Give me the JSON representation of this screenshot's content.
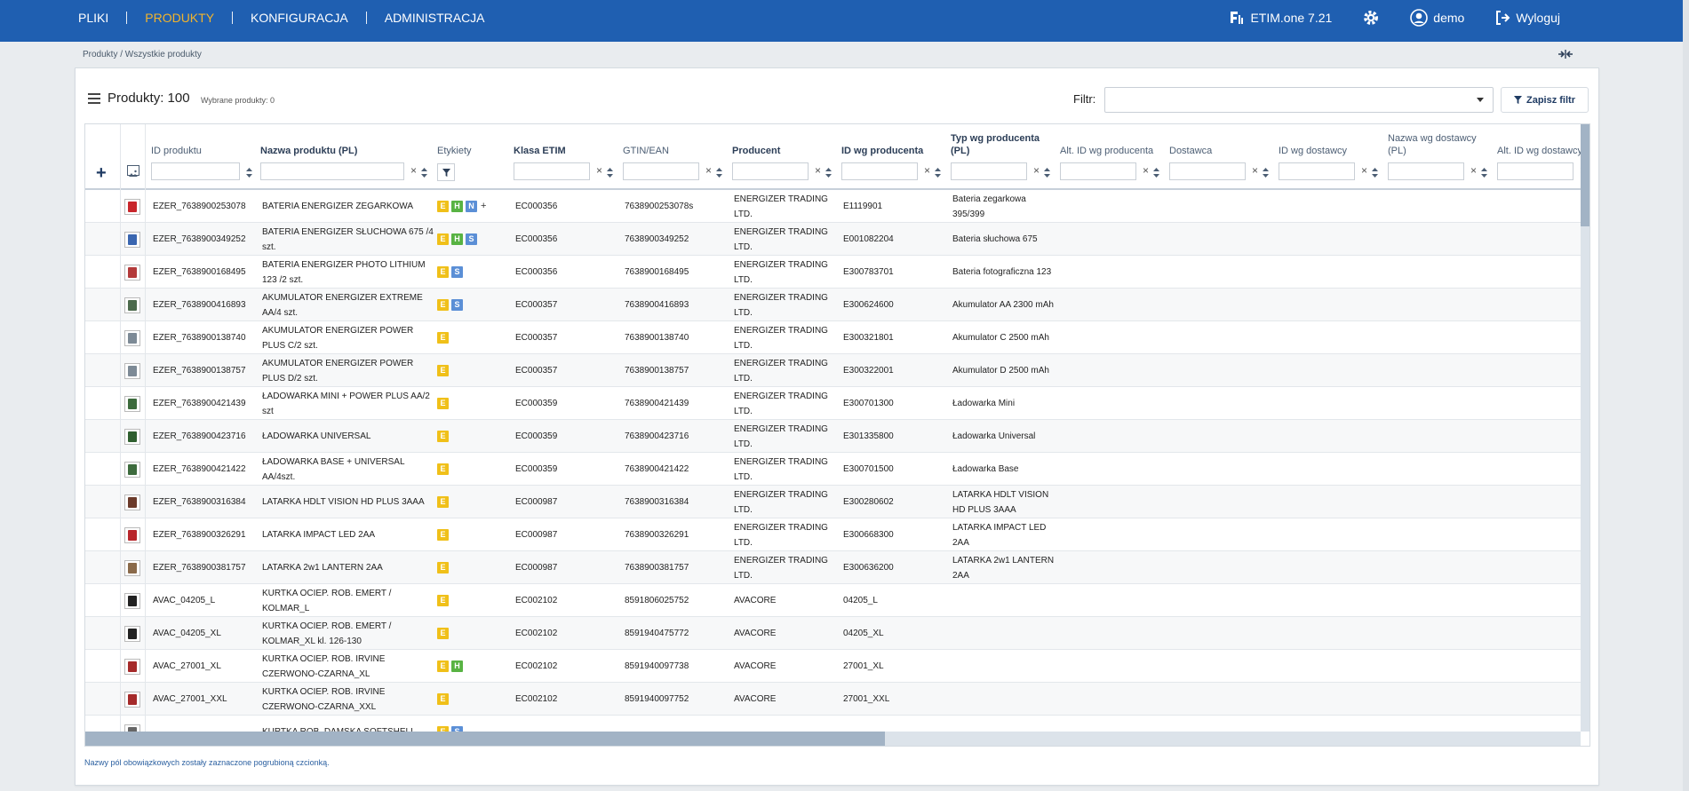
{
  "nav": {
    "items": [
      {
        "label": "PLIKI",
        "active": false
      },
      {
        "label": "PRODUKTY",
        "active": true
      },
      {
        "label": "KONFIGURACJA",
        "active": false
      },
      {
        "label": "ADMINISTRACJA",
        "active": false
      }
    ],
    "version": "ETIM.one 7.21",
    "user": "demo",
    "logout": "Wyloguj"
  },
  "breadcrumb": "Produkty / Wszystkie produkty",
  "panel": {
    "title": "Produkty: 100",
    "selected": "Wybrane produkty: 0",
    "filter_label": "Filtr:",
    "filter_value": "",
    "save_filter": "Zapisz filtr"
  },
  "columns": [
    {
      "label": "ID produktu",
      "required": false
    },
    {
      "label": "Nazwa produktu (PL)",
      "required": true
    },
    {
      "label": "Etykiety",
      "required": false
    },
    {
      "label": "Klasa ETIM",
      "required": true
    },
    {
      "label": "GTIN/EAN",
      "required": false
    },
    {
      "label": "Producent",
      "required": true
    },
    {
      "label": "ID wg producenta",
      "required": true
    },
    {
      "label": "Typ wg producenta (PL)",
      "required": true
    },
    {
      "label": "Alt. ID wg producenta",
      "required": false
    },
    {
      "label": "Dostawca",
      "required": false
    },
    {
      "label": "ID wg dostawcy",
      "required": false
    },
    {
      "label": "Nazwa wg dostawcy (PL)",
      "required": false
    },
    {
      "label": "Alt. ID wg dostawcy",
      "required": false
    }
  ],
  "rows": [
    {
      "thumb": "#c8262b",
      "id": "EZER_7638900253078",
      "name": "BATERIA ENERGIZER ZEGARKOWA",
      "tags": [
        "E",
        "H",
        "N"
      ],
      "more": "+",
      "cls": "EC000356",
      "gtin": "7638900253078s",
      "prod": "ENERGIZER TRADING LTD.",
      "pid": "E1119901",
      "ptype": "Bateria zegarkowa 395/399"
    },
    {
      "thumb": "#3a66b0",
      "id": "EZER_7638900349252",
      "name": "BATERIA ENERGIZER SŁUCHOWA 675 /4 szt.",
      "tags": [
        "E",
        "H",
        "S"
      ],
      "more": "",
      "cls": "EC000356",
      "gtin": "7638900349252",
      "prod": "ENERGIZER TRADING LTD.",
      "pid": "E001082204",
      "ptype": "Bateria słuchowa 675"
    },
    {
      "thumb": "#b33a3a",
      "id": "EZER_7638900168495",
      "name": "BATERIA ENERGIZER PHOTO LITHIUM 123 /2 szt.",
      "tags": [
        "E",
        "S"
      ],
      "more": "",
      "cls": "EC000356",
      "gtin": "7638900168495",
      "prod": "ENERGIZER TRADING LTD.",
      "pid": "E300783701",
      "ptype": "Bateria fotograficzna 123"
    },
    {
      "thumb": "#4c6a4c",
      "id": "EZER_7638900416893",
      "name": "AKUMULATOR ENERGIZER EXTREME AA/4 szt.",
      "tags": [
        "E",
        "S"
      ],
      "more": "",
      "cls": "EC000357",
      "gtin": "7638900416893",
      "prod": "ENERGIZER TRADING LTD.",
      "pid": "E300624600",
      "ptype": "Akumulator AA 2300 mAh"
    },
    {
      "thumb": "#7d8a96",
      "id": "EZER_7638900138740",
      "name": "AKUMULATOR ENERGIZER POWER PLUS C/2 szt.",
      "tags": [
        "E"
      ],
      "more": "",
      "cls": "EC000357",
      "gtin": "7638900138740",
      "prod": "ENERGIZER TRADING LTD.",
      "pid": "E300321801",
      "ptype": "Akumulator C 2500 mAh"
    },
    {
      "thumb": "#7d8a96",
      "id": "EZER_7638900138757",
      "name": "AKUMULATOR ENERGIZER POWER PLUS D/2 szt.",
      "tags": [
        "E"
      ],
      "more": "",
      "cls": "EC000357",
      "gtin": "7638900138757",
      "prod": "ENERGIZER TRADING LTD.",
      "pid": "E300322001",
      "ptype": "Akumulator D 2500 mAh"
    },
    {
      "thumb": "#3d6b3d",
      "id": "EZER_7638900421439",
      "name": "ŁADOWARKA MINI + POWER PLUS AA/2 szt",
      "tags": [
        "E"
      ],
      "more": "",
      "cls": "EC000359",
      "gtin": "7638900421439",
      "prod": "ENERGIZER TRADING LTD.",
      "pid": "E300701300",
      "ptype": "Ładowarka Mini"
    },
    {
      "thumb": "#2f5f2f",
      "id": "EZER_7638900423716",
      "name": "ŁADOWARKA UNIVERSAL",
      "tags": [
        "E"
      ],
      "more": "",
      "cls": "EC000359",
      "gtin": "7638900423716",
      "prod": "ENERGIZER TRADING LTD.",
      "pid": "E301335800",
      "ptype": "Ładowarka Universal"
    },
    {
      "thumb": "#3d6b3d",
      "id": "EZER_7638900421422",
      "name": "ŁADOWARKA BASE + UNIVERSAL AA/4szt.",
      "tags": [
        "E"
      ],
      "more": "",
      "cls": "EC000359",
      "gtin": "7638900421422",
      "prod": "ENERGIZER TRADING LTD.",
      "pid": "E300701500",
      "ptype": "Ładowarka Base"
    },
    {
      "thumb": "#6b3a2a",
      "id": "EZER_7638900316384",
      "name": "LATARKA HDLT VISION HD PLUS 3AAA",
      "tags": [
        "E"
      ],
      "more": "",
      "cls": "EC000987",
      "gtin": "7638900316384",
      "prod": "ENERGIZER TRADING LTD.",
      "pid": "E300280602",
      "ptype": "LATARKA HDLT VISION HD PLUS 3AAA"
    },
    {
      "thumb": "#b8262b",
      "id": "EZER_7638900326291",
      "name": "LATARKA IMPACT LED 2AA",
      "tags": [
        "E"
      ],
      "more": "",
      "cls": "EC000987",
      "gtin": "7638900326291",
      "prod": "ENERGIZER TRADING LTD.",
      "pid": "E300668300",
      "ptype": "LATARKA IMPACT LED 2AA"
    },
    {
      "thumb": "#8a6a4a",
      "id": "EZER_7638900381757",
      "name": "LATARKA 2w1 LANTERN 2AA",
      "tags": [
        "E"
      ],
      "more": "",
      "cls": "EC000987",
      "gtin": "7638900381757",
      "prod": "ENERGIZER TRADING LTD.",
      "pid": "E300636200",
      "ptype": "LATARKA 2w1 LANTERN 2AA"
    },
    {
      "thumb": "#222222",
      "id": "AVAC_04205_L",
      "name": "KURTKA OCIEP. ROB. EMERT / KOLMAR_L",
      "tags": [
        "E"
      ],
      "more": "",
      "cls": "EC002102",
      "gtin": "8591806025752",
      "prod": "AVACORE",
      "pid": "04205_L",
      "ptype": ""
    },
    {
      "thumb": "#222222",
      "id": "AVAC_04205_XL",
      "name": "KURTKA OCIEP. ROB. EMERT / KOLMAR_XL kl. 126-130",
      "tags": [
        "E"
      ],
      "more": "",
      "cls": "EC002102",
      "gtin": "8591940475772",
      "prod": "AVACORE",
      "pid": "04205_XL",
      "ptype": ""
    },
    {
      "thumb": "#a52a2a",
      "id": "AVAC_27001_XL",
      "name": "KURTKA OCIEP. ROB. IRVINE CZERWONO-CZARNA_XL",
      "tags": [
        "E",
        "H"
      ],
      "more": "",
      "cls": "EC002102",
      "gtin": "8591940097738",
      "prod": "AVACORE",
      "pid": "27001_XL",
      "ptype": ""
    },
    {
      "thumb": "#a52a2a",
      "id": "AVAC_27001_XXL",
      "name": "KURTKA OCIEP. ROB. IRVINE CZERWONO-CZARNA_XXL",
      "tags": [
        "E"
      ],
      "more": "",
      "cls": "EC002102",
      "gtin": "8591940097752",
      "prod": "AVACORE",
      "pid": "27001_XXL",
      "ptype": ""
    },
    {
      "thumb": "#666666",
      "id": "",
      "name": "KURTKA ROB. DAMSKA SOFTSHELL",
      "tags": [
        "E",
        "S"
      ],
      "more": "",
      "cls": "",
      "gtin": "",
      "prod": "",
      "pid": "",
      "ptype": ""
    }
  ],
  "footer_note": "Nazwy pól obowiązkowych zostały zaznaczone pogrubioną czcionką."
}
